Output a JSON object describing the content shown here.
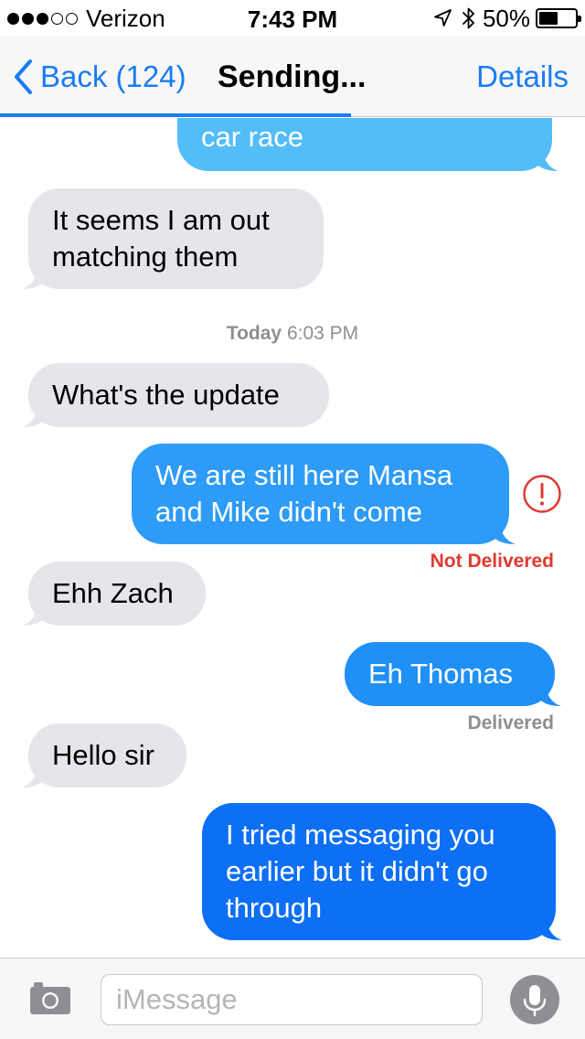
{
  "status_bar": {
    "signal_bars_filled": 3,
    "signal_bars_total": 5,
    "carrier": "Verizon",
    "time": "7:43 PM",
    "battery": "50%",
    "battery_level": 0.5,
    "icons": [
      "location-arrow-icon",
      "bluetooth-icon",
      "battery-icon"
    ]
  },
  "nav": {
    "back_label": "Back (124)",
    "title": "Sending...",
    "details_label": "Details",
    "send_progress": 0.6
  },
  "messages": [
    {
      "direction": "outgoing",
      "text": "car race",
      "partial": true
    },
    {
      "direction": "incoming",
      "lines": [
        "It seems I am out",
        "matching them"
      ]
    },
    {
      "type": "timestamp",
      "day": "Today",
      "time": "6:03 PM"
    },
    {
      "direction": "incoming",
      "text": "What's the update"
    },
    {
      "direction": "outgoing",
      "lines": [
        "We are still here Mansa",
        "and Mike didn't come"
      ],
      "status": "Not Delivered",
      "error_icon": "exclamation-circle-icon"
    },
    {
      "direction": "incoming",
      "text": "Ehh Zach"
    },
    {
      "direction": "outgoing",
      "text": "Eh Thomas",
      "status": "Delivered"
    },
    {
      "direction": "incoming",
      "text": "Hello sir"
    },
    {
      "direction": "outgoing",
      "lines": [
        "I tried messaging you",
        "earlier but it didn't go",
        "through"
      ]
    }
  ],
  "input_bar": {
    "placeholder": "iMessage",
    "camera_icon": "camera-icon",
    "mic_icon": "microphone-icon"
  },
  "colors": {
    "ios_blue": "#1a7cf5",
    "incoming_bubble": "#e5e5ea",
    "error_red": "#e03a2f",
    "gray_text": "#8e8e93"
  }
}
